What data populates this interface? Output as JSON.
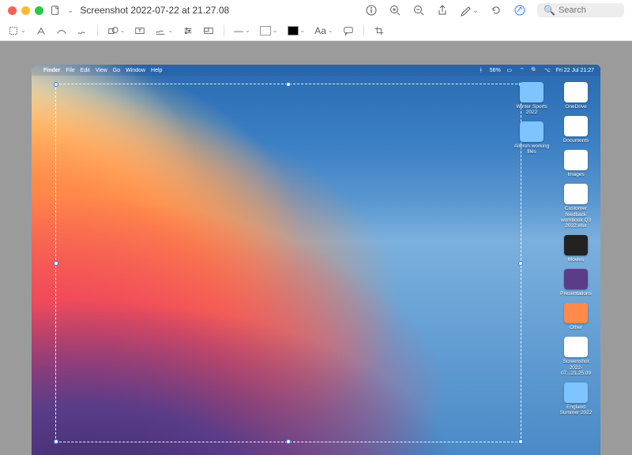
{
  "window": {
    "title": "Screenshot 2022-07-22 at 21.27.08",
    "search_placeholder": "Search"
  },
  "toolbar": {
    "line_weight": "—",
    "text_size": "Aa"
  },
  "mac_menubar": {
    "app": "Finder",
    "items": [
      "File",
      "Edit",
      "View",
      "Go",
      "Window",
      "Help"
    ],
    "battery_pct": "56%",
    "clock": "Fri 22 Jul  21:27"
  },
  "desktop_icons_col1": [
    {
      "label": "Winter Sports 2022",
      "kind": "folder"
    },
    {
      "label": "Aileron working files",
      "kind": "folder"
    }
  ],
  "desktop_icons_col2": [
    {
      "label": "OneDrive",
      "kind": "app"
    },
    {
      "label": "Documents",
      "kind": "doc"
    },
    {
      "label": "Images",
      "kind": "doc"
    },
    {
      "label": "Customer feedback workbook Q3 2022.xlsx",
      "kind": "doc"
    },
    {
      "label": "Movies",
      "kind": "dark"
    },
    {
      "label": "Presentations",
      "kind": "purple"
    },
    {
      "label": "Other",
      "kind": "orange"
    },
    {
      "label": "Screenshot 2022-07...21.25.09",
      "kind": "doc"
    },
    {
      "label": "England Summer 2022",
      "kind": "folder"
    }
  ]
}
